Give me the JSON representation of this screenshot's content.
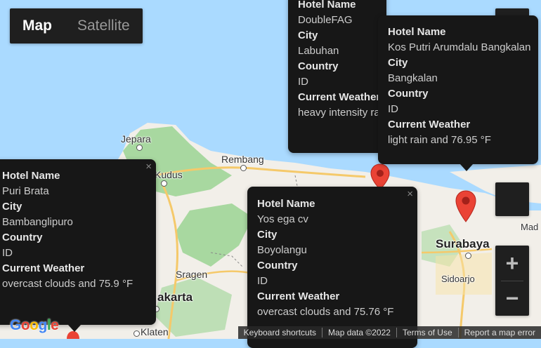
{
  "map_type": {
    "map_label": "Map",
    "satellite_label": "Satellite"
  },
  "places": {
    "jepara": "Jepara",
    "rembang": "Rembang",
    "kudus": "Kudus",
    "sragen": "Sragen",
    "surakarta": "akarta",
    "klaten": "Klaten",
    "surabaya": "Surabaya",
    "sidoarjo": "Sidoarjo",
    "madura": "Mad"
  },
  "info_windows": [
    {
      "hotel_label": "Hotel Name",
      "hotel": "DoubleFAG",
      "city_label": "City",
      "city": "Labuhan",
      "country_label": "Country",
      "country": "ID",
      "weather_label": "Current Weather",
      "weather": "heavy intensity rain"
    },
    {
      "hotel_label": "Hotel Name",
      "hotel": "Kos Putri Arumdalu Bangkalan",
      "city_label": "City",
      "city": "Bangkalan",
      "country_label": "Country",
      "country": "ID",
      "weather_label": "Current Weather",
      "weather": "light rain and 76.95 °F"
    },
    {
      "hotel_label": "Hotel Name",
      "hotel": "Puri Brata",
      "city_label": "City",
      "city": "Bambanglipuro",
      "country_label": "Country",
      "country": "ID",
      "weather_label": "Current Weather",
      "weather": "overcast clouds and 75.9 °F"
    },
    {
      "hotel_label": "Hotel Name",
      "hotel": "Yos ega cv",
      "city_label": "City",
      "city": "Boyolangu",
      "country_label": "Country",
      "country": "ID",
      "weather_label": "Current Weather",
      "weather": "overcast clouds and 75.76 °F"
    }
  ],
  "footer": {
    "shortcuts": "Keyboard shortcuts",
    "map_data": "Map data ©2022",
    "terms": "Terms of Use",
    "report": "Report a map error"
  },
  "logo": "Google",
  "zoom": {
    "in": "+",
    "out": "−"
  },
  "close_glyph": "×",
  "colors": {
    "water": "#aadaff",
    "land": "#f2efe9",
    "green": "#a8d8a0",
    "marker": "#ea4335",
    "popup": "#171717"
  }
}
